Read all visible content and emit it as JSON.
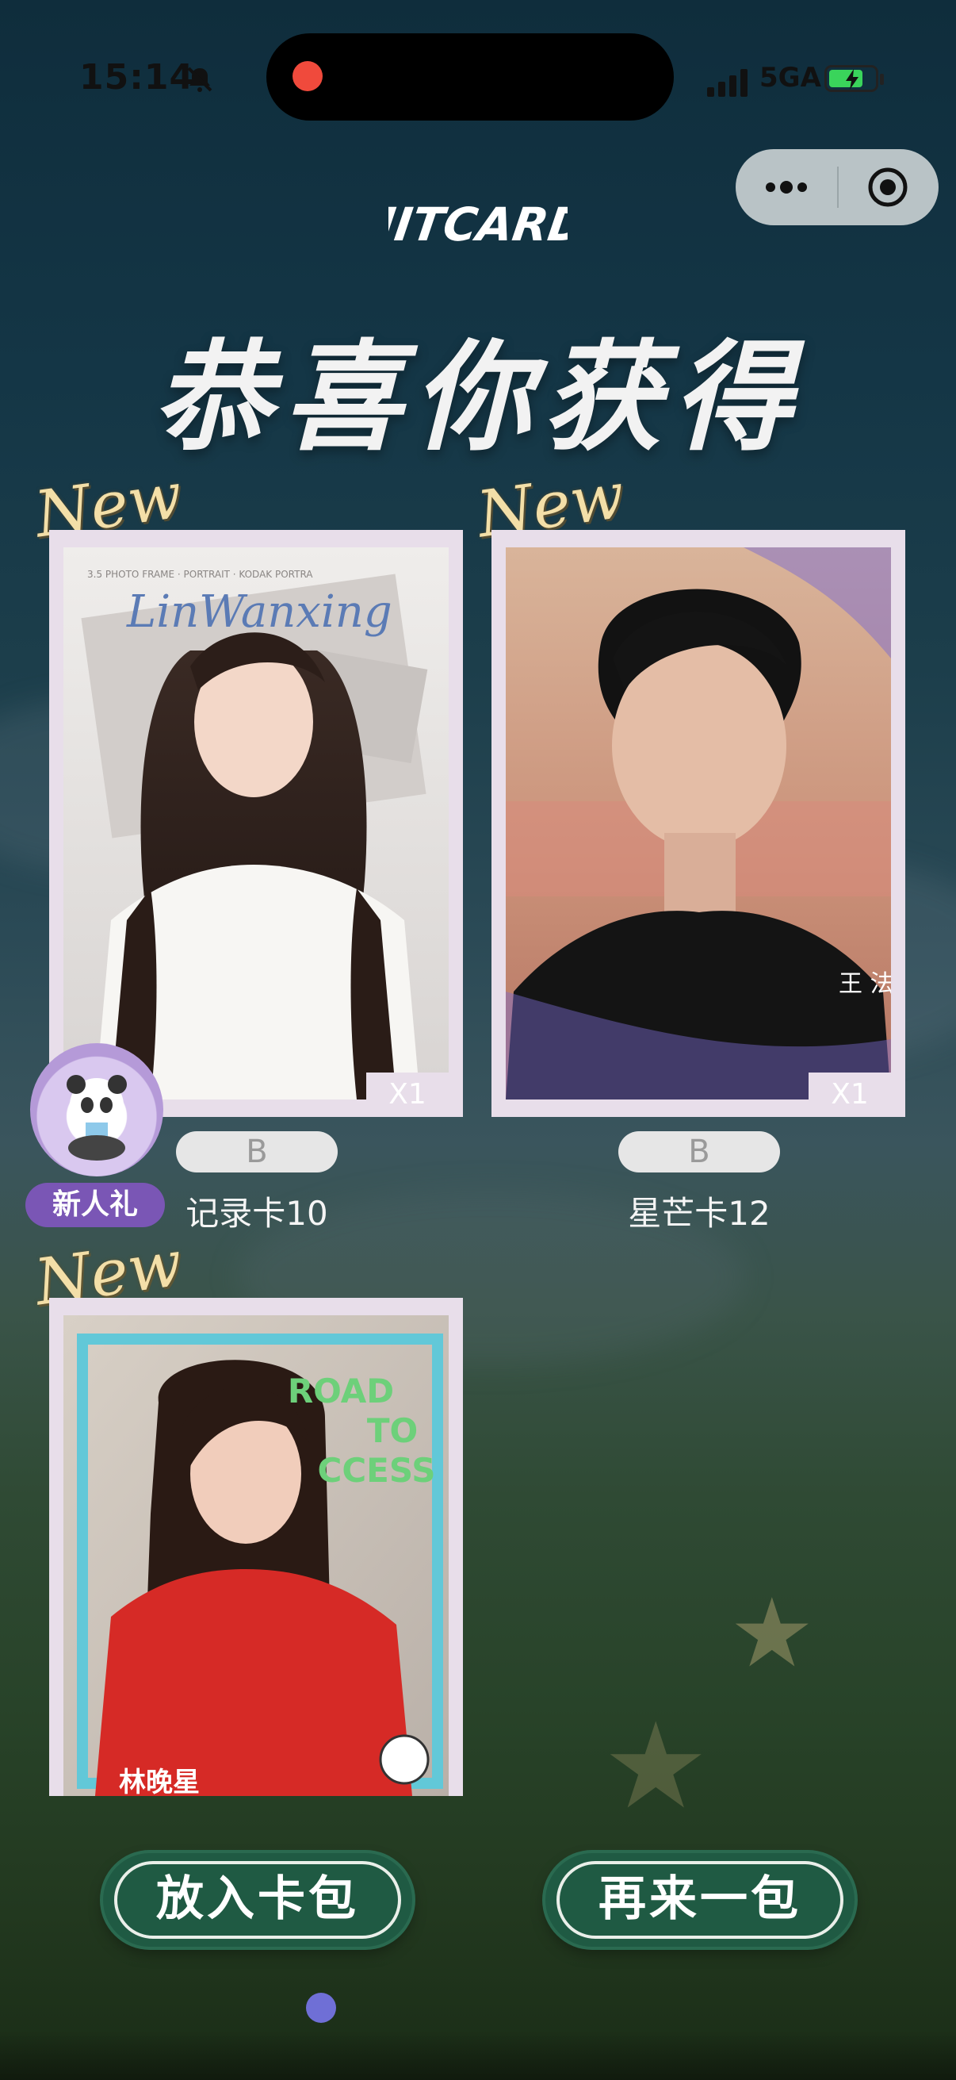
{
  "status_bar": {
    "time": "15:14",
    "network": "5GA"
  },
  "brand_logo": "HITCARD",
  "title": "恭喜你获得",
  "new_badge": "New",
  "cards": [
    {
      "grade": "B",
      "name": "记录卡10",
      "quantity": "X1",
      "photo_text": "LinWanxing",
      "header_text": "3.5 PHOTO FRAME · PORTRAIT · KODAK PORTRA"
    },
    {
      "grade": "B",
      "name": "星芒卡12",
      "quantity": "X1",
      "signature": "王 法"
    },
    {
      "photo_text_1": "ROAD",
      "photo_text_2": "TO",
      "photo_text_3": "CCESS",
      "bottom_name": "林晚星"
    }
  ],
  "gift_badge": {
    "label": "新人礼"
  },
  "buttons": {
    "add_to_pack": "放入卡包",
    "draw_again": "再来一包"
  },
  "colors": {
    "button": "#1f5a43",
    "card_frame": "#e8deea",
    "gift_tag": "#7a56b5",
    "record_dot": "#f04a3c"
  }
}
